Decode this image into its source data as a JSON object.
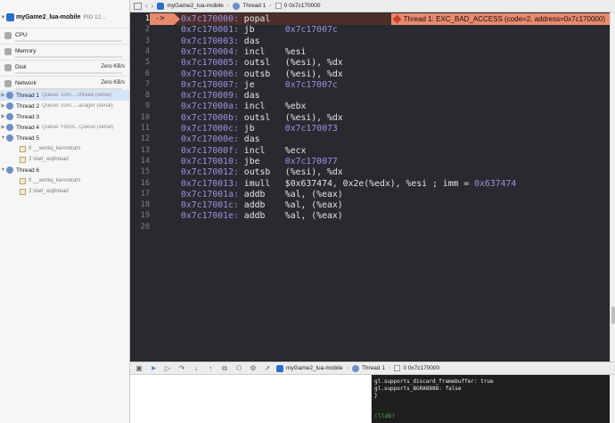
{
  "navigator": {
    "process_name": "myGame2_lua-mobile",
    "process_pid": "PID 12...",
    "gauges": [
      {
        "label": "CPU",
        "value": ""
      },
      {
        "label": "Memory",
        "value": ""
      },
      {
        "label": "Disk",
        "value": "Zero KB/s"
      },
      {
        "label": "Network",
        "value": "Zero KB/s"
      }
    ],
    "threads": [
      {
        "label": "Thread 1",
        "queue": "Queue: com.....thread (serial)",
        "selected": true
      },
      {
        "label": "Thread 2",
        "queue": "Queue: com.....anager (serial)"
      },
      {
        "label": "Thread 3",
        "queue": ""
      },
      {
        "label": "Thread 4",
        "queue": "Queue: FBSS...Queue (serial)"
      },
      {
        "label": "Thread 5",
        "queue": ""
      },
      {
        "label": "Thread 6",
        "queue": ""
      }
    ],
    "frames": {
      "thread5": [
        "0 __workq_kernreturn",
        "2 start_wqthread"
      ],
      "thread6": [
        "0 __workq_kernreturn",
        "2 start_wqthread"
      ]
    }
  },
  "jumpbar": {
    "target": "myGame2_lua-mobile",
    "thread": "Thread 1",
    "frame": "0 0x7c170000"
  },
  "editor": {
    "pc_marker": "->",
    "exception": "Thread 1: EXC_BAD_ACCESS (code=2, address=0x7c170000)",
    "lines": [
      {
        "n": "1",
        "addr": "0x7c170000:",
        "op": "popal",
        "arg": "",
        "hex": "",
        "tail": ""
      },
      {
        "n": "2",
        "addr": "0x7c170001:",
        "op": "jb",
        "arg": "",
        "hex": "0x7c17007c",
        "tail": ""
      },
      {
        "n": "3",
        "addr": "0x7c170003:",
        "op": "das",
        "arg": "",
        "hex": "",
        "tail": ""
      },
      {
        "n": "4",
        "addr": "0x7c170004:",
        "op": "incl",
        "arg": "%esi",
        "hex": "",
        "tail": ""
      },
      {
        "n": "5",
        "addr": "0x7c170005:",
        "op": "outsl",
        "arg": "(%esi), %dx",
        "hex": "",
        "tail": ""
      },
      {
        "n": "6",
        "addr": "0x7c170006:",
        "op": "outsb",
        "arg": "(%esi), %dx",
        "hex": "",
        "tail": ""
      },
      {
        "n": "7",
        "addr": "0x7c170007:",
        "op": "je",
        "arg": "",
        "hex": "0x7c17007c",
        "tail": ""
      },
      {
        "n": "8",
        "addr": "0x7c170009:",
        "op": "das",
        "arg": "",
        "hex": "",
        "tail": ""
      },
      {
        "n": "9",
        "addr": "0x7c17000a:",
        "op": "incl",
        "arg": "%ebx",
        "hex": "",
        "tail": ""
      },
      {
        "n": "10",
        "addr": "0x7c17000b:",
        "op": "outsl",
        "arg": "(%esi), %dx",
        "hex": "",
        "tail": ""
      },
      {
        "n": "11",
        "addr": "0x7c17000c:",
        "op": "jb",
        "arg": "",
        "hex": "0x7c170073",
        "tail": ""
      },
      {
        "n": "12",
        "addr": "0x7c17000e:",
        "op": "das",
        "arg": "",
        "hex": "",
        "tail": ""
      },
      {
        "n": "13",
        "addr": "0x7c17000f:",
        "op": "incl",
        "arg": "%ecx",
        "hex": "",
        "tail": ""
      },
      {
        "n": "14",
        "addr": "0x7c170010:",
        "op": "jbe",
        "arg": "",
        "hex": "0x7c170077",
        "tail": ""
      },
      {
        "n": "15",
        "addr": "0x7c170012:",
        "op": "outsb",
        "arg": "(%esi), %dx",
        "hex": "",
        "tail": ""
      },
      {
        "n": "16",
        "addr": "0x7c170013:",
        "op": "imull",
        "arg": "$0x637474, 0x2e(%edx), %esi ; imm = ",
        "hex": "0x637474",
        "tail": ""
      },
      {
        "n": "17",
        "addr": "0x7c17001a:",
        "op": "addb",
        "arg": "%al, (%eax)",
        "hex": "",
        "tail": ""
      },
      {
        "n": "18",
        "addr": "0x7c17001c:",
        "op": "addb",
        "arg": "%al, (%eax)",
        "hex": "",
        "tail": ""
      },
      {
        "n": "19",
        "addr": "0x7c17001e:",
        "op": "addb",
        "arg": "%al, (%eax)",
        "hex": "",
        "tail": ""
      },
      {
        "n": "20",
        "addr": "",
        "op": "",
        "arg": "",
        "hex": "",
        "tail": ""
      }
    ]
  },
  "debugbar": {
    "target": "myGame2_lua-mobile",
    "thread": "Thread 1",
    "frame": "0 0x7c170000"
  },
  "console": {
    "lines": [
      "gl.supports_discard_framebuffer: true",
      "gl.supports_BGRA8888: false",
      "}"
    ],
    "prompt": "(lldb)"
  }
}
